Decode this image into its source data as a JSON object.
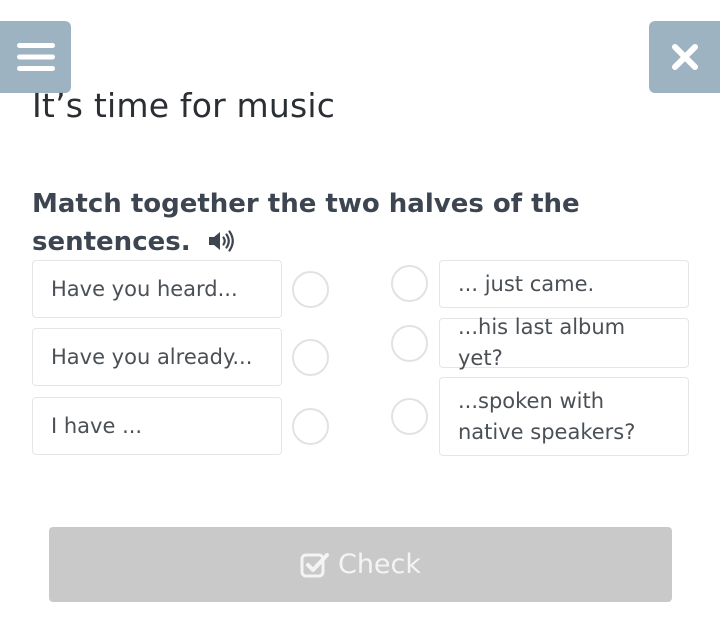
{
  "header": {
    "menu_icon": "hamburger-menu-icon",
    "close_icon": "close-icon",
    "accent_color": "#9eb3c2"
  },
  "page": {
    "title": "It’s time for music"
  },
  "task": {
    "instruction": "Match together the two halves of the sentences.",
    "speaker_icon": "speaker-icon"
  },
  "left_items": [
    {
      "text": "Have you heard..."
    },
    {
      "text": "Have you already..."
    },
    {
      "text": "I have ..."
    }
  ],
  "right_items": [
    {
      "text": "... just came."
    },
    {
      "text": "...his last album yet?"
    },
    {
      "text": "...spoken with native speakers?"
    }
  ],
  "actions": {
    "check_label": "Check",
    "check_icon": "check-square-icon",
    "disabled_color": "#c9c9c9"
  }
}
